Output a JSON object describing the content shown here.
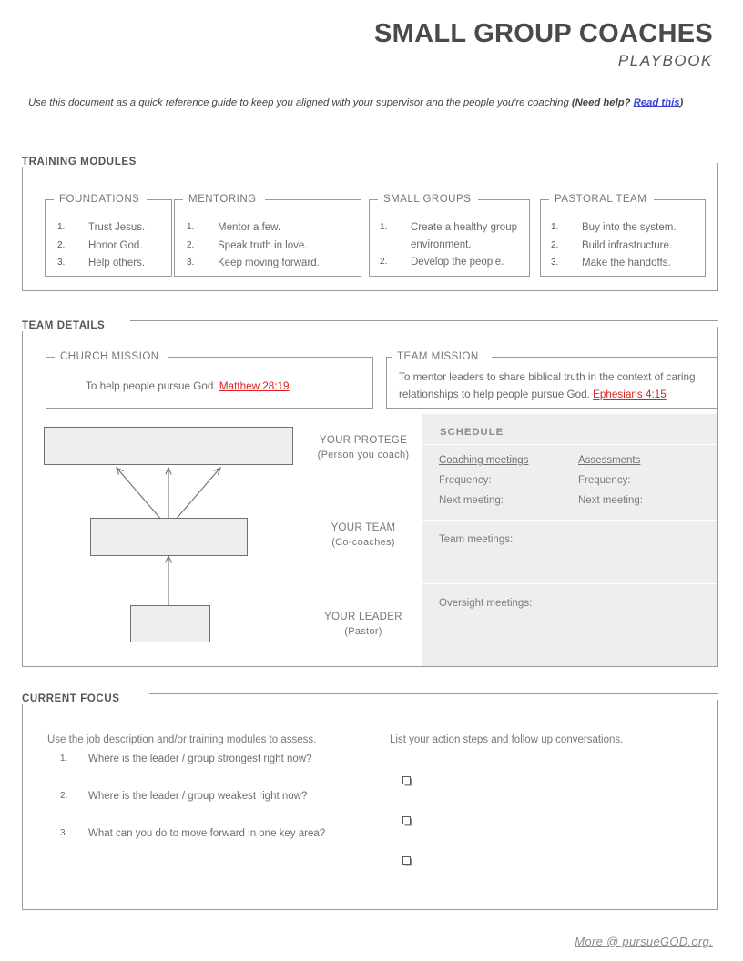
{
  "header": {
    "title": "SMALL GROUP COACHES",
    "subtitle": "PLAYBOOK"
  },
  "intro": {
    "lead": "Use this document as a quick reference guide to keep you aligned with your supervisor and the people you're coaching ",
    "bold_open": "(Need help? ",
    "link": "Read this",
    "bold_close": ")"
  },
  "sections": {
    "training_modules": {
      "label": "TRAINING MODULES",
      "modules": [
        {
          "title": "FOUNDATIONS",
          "items": [
            {
              "num": "1.",
              "text": "Trust Jesus."
            },
            {
              "num": "2.",
              "text": "Honor God."
            },
            {
              "num": "3.",
              "text": "Help others."
            }
          ]
        },
        {
          "title": "MENTORING",
          "items": [
            {
              "num": "1.",
              "text": "Mentor a few."
            },
            {
              "num": "2.",
              "text": "Speak truth in love."
            },
            {
              "num": "3.",
              "text": "Keep moving forward."
            }
          ]
        },
        {
          "title": "SMALL GROUPS",
          "items": [
            {
              "num": "1.",
              "text": "Create a healthy group environment."
            },
            {
              "num": "2.",
              "text": "Develop the people."
            }
          ]
        },
        {
          "title": "PASTORAL TEAM",
          "items": [
            {
              "num": "1.",
              "text": "Buy into the system."
            },
            {
              "num": "2.",
              "text": "Build infrastructure."
            },
            {
              "num": "3.",
              "text": "Make the handoffs."
            }
          ]
        }
      ]
    },
    "team_details": {
      "label": "TEAM DETAILS",
      "church_mission": {
        "title": "CHURCH MISSION",
        "text": "To help people pursue God. ",
        "reference": "Matthew 28:19"
      },
      "team_mission": {
        "title": "TEAM MISSION",
        "text": "To mentor leaders to share biblical truth in the context of caring relationships to help people pursue God. ",
        "reference": "Ephesians 4:15"
      },
      "org_chart": {
        "levels": [
          {
            "label": "YOUR PROTEGE",
            "sub": "(Person you coach)"
          },
          {
            "label": "YOUR TEAM",
            "sub": "(Co-coaches)"
          },
          {
            "label": "YOUR LEADER",
            "sub": "(Pastor)"
          }
        ]
      },
      "schedule": {
        "title": "SCHEDULE",
        "columns": [
          {
            "heading": "Coaching meetings",
            "rows": [
              "Frequency:",
              "Next meeting:"
            ]
          },
          {
            "heading": "Assessments",
            "rows": [
              "Frequency:",
              "Next meeting:"
            ]
          }
        ],
        "team_meetings": "Team meetings:",
        "oversight_meetings": "Oversight meetings:"
      }
    },
    "current_focus": {
      "label": "CURRENT FOCUS",
      "left_intro": "Use the job description and/or training modules to assess.",
      "questions": [
        {
          "num": "1.",
          "text": "Where is the leader / group strongest right now?"
        },
        {
          "num": "2.",
          "text": "Where is the leader / group weakest right now?"
        },
        {
          "num": "3.",
          "text": "What can you do to move forward in one key area?"
        }
      ],
      "right_intro": "List your action steps and follow up conversations.",
      "checkbox_count": 3
    }
  },
  "footer": {
    "link": "More @ pursueGOD.org."
  },
  "colors": {
    "title": "#4a4a4a",
    "body_text": "#6a6a6a",
    "border": "#9a9a9a",
    "scripture_link": "#e02020",
    "intro_link": "#3b46d6",
    "panel_fill": "#eeeeee",
    "box_fill": "#ededed"
  }
}
